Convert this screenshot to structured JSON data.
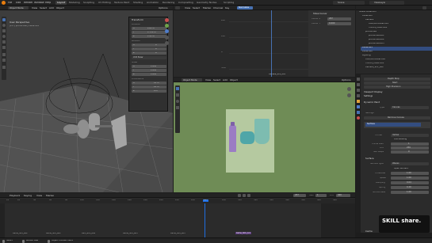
{
  "topbar": {
    "menus": [
      "File",
      "Edit",
      "Render",
      "Window",
      "Help"
    ],
    "workspaces": [
      "Layout",
      "Modeling",
      "Sculpting",
      "UV Editing",
      "Texture Paint",
      "Shading",
      "Animation",
      "Rendering",
      "Compositing",
      "Geometry Nodes",
      "Scripting"
    ],
    "active_workspace": "Layout",
    "scene": "Scene",
    "view_layer": "ViewLayer"
  },
  "viewport3d": {
    "mode": "Object Mode",
    "menus": [
      "View",
      "Select",
      "Add",
      "Object"
    ],
    "perspective": "User Perspective",
    "collection": "(257) productive | Plane.001",
    "options_label": "Options",
    "transform_title": "Transform",
    "location_label": "Location",
    "location": [
      "X",
      "2.61 m",
      "Y",
      "1.710 m",
      "Z",
      "1.93 m"
    ],
    "rotation_label": "Rotation",
    "rotation": [
      "X",
      "0°",
      "Y",
      "0°",
      "Z",
      "0°"
    ],
    "rotation_mode": "XYZ Euler",
    "scale_label": "Scale",
    "scale": [
      "X",
      "1.000",
      "Y",
      "1.000",
      "Z",
      "1.000"
    ],
    "dimensions_label": "Dimensions",
    "dimensions": [
      "X",
      "10 m",
      "Y",
      "10 m",
      "Z",
      "0 m"
    ]
  },
  "graph_editor": {
    "menus": [
      "View",
      "Select",
      "Marker",
      "Channel",
      "Key"
    ],
    "normalize": "Normalize",
    "y_ticks": [
      "200",
      "100",
      "0",
      "-100"
    ],
    "show_cursor": "Show Cursor",
    "cursor_x_label": "Cursor X",
    "cursor_x": "257",
    "cursor_y_label": "Cursor Y",
    "cursor_y": "0.000",
    "frame_label": "Camera_SC1_001"
  },
  "camera_view": {
    "mode": "Object Mode",
    "menus": [
      "View",
      "Select",
      "Add",
      "Object"
    ],
    "options_label": "Options"
  },
  "outliner": {
    "title": "Scene Collection",
    "rows": [
      "Scene Collection",
      "Collection",
      "Camera",
      "CAM/Controller.001",
      "FOCUS_CAM1.001",
      "productive",
      "productive.001",
      "productive.002",
      "productive.003",
      "Plane.001",
      "Plane.002",
      "Lighting",
      "CAM/Controller.002",
      "FOCUS_CAM2.001",
      "Camera_SC1_002"
    ]
  },
  "properties": {
    "buttons": [
      "Depth Stop",
      "Start",
      "High Precision"
    ],
    "sections": [
      "Viewport Display",
      "Settings",
      "Dynamic Paint"
    ],
    "type_label": "Type",
    "type_value": "Canvas",
    "remove_canvas": "Remove Canvas",
    "surface_label": "Surface",
    "format_label": "Format",
    "format_value": "Vertex",
    "anti_aliasing": "Anti-aliasing",
    "frame_start_label": "Frame Start",
    "frame_start": "1",
    "end_label": "End",
    "end": "250",
    "substeps_label": "Sub Steps",
    "substeps": "0",
    "surface_type_label": "Surface Type",
    "surface_type": "Waves",
    "open_borders": "Open Borders",
    "timescale_label": "Timescale",
    "timescale": "1.00",
    "speed_label": "Speed",
    "speed": "1.00",
    "damping_label": "Damping",
    "damping": "0.04",
    "spring_label": "Spring",
    "spring": "0.20",
    "smoothness_label": "Smoothness",
    "smoothness": "1.00",
    "cache_label": "Cache"
  },
  "timeline": {
    "menus": [
      "Playback",
      "Keying",
      "View",
      "Marker"
    ],
    "current_frame": "257",
    "start_label": "Start",
    "start": "1",
    "end_label": "End",
    "end": "400",
    "ruler": [
      "10",
      "20",
      "40",
      "60",
      "80",
      "100",
      "120",
      "140",
      "160",
      "180",
      "200",
      "220",
      "240",
      "257",
      "280",
      "300",
      "320",
      "340",
      "360",
      "380",
      "400",
      "420"
    ],
    "markers": [
      "Camo_SC1_002",
      "Camo_SC1_001",
      "Cam_SC1_004",
      "Camo_SC1_003",
      "Camo_SC1_005"
    ],
    "active_marker": "Camo_SC1_4.4"
  },
  "statusbar": {
    "left": "Select",
    "middle": "Rotate View",
    "right": "Object Context Menu"
  },
  "watermark": "SKILL share.",
  "colors": {
    "accent": "#4772b3",
    "timeline_cursor": "#1f6ee0",
    "camera_bg": "#6f8c56",
    "plane": "#b5c9a0",
    "purple_bottle": "#9b7cc4",
    "teal_jar": "#4fa6a8",
    "teal_tube": "#7dbcb0"
  }
}
